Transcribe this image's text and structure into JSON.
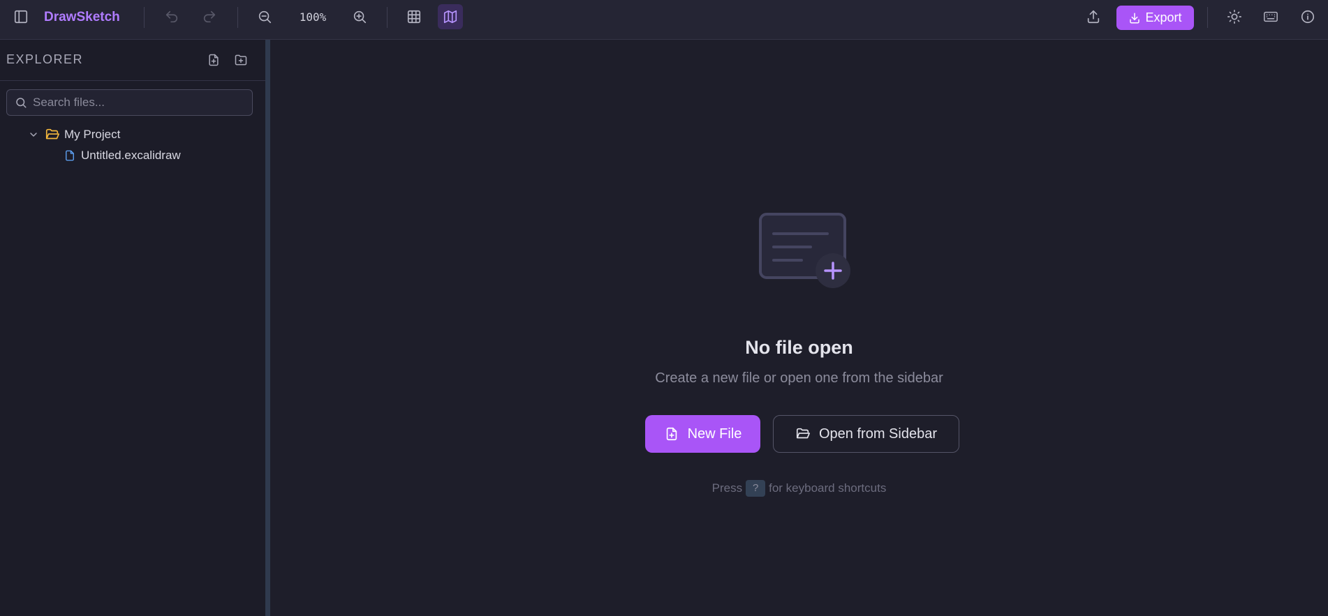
{
  "app": {
    "brand": "DrawSketch"
  },
  "toolbar": {
    "zoom_level": "100%",
    "export_label": "Export",
    "icons": [
      "sidebar-toggle-icon",
      "undo-icon",
      "redo-icon",
      "zoom-out-icon",
      "zoom-in-icon",
      "grid-icon",
      "map-icon",
      "upload-icon",
      "download-icon",
      "sun-icon",
      "keyboard-icon",
      "info-icon"
    ]
  },
  "sidebar": {
    "title": "EXPLORER",
    "search_placeholder": "Search files...",
    "tree": [
      {
        "type": "folder",
        "label": "My Project",
        "expanded": true
      },
      {
        "type": "file",
        "label": "Untitled.excalidraw"
      }
    ]
  },
  "main": {
    "empty_title": "No file open",
    "empty_subtitle": "Create a new file or open one from the sidebar",
    "new_file_label": "New File",
    "open_label": "Open from Sidebar",
    "hint_before": "Press",
    "hint_key": "?",
    "hint_after": "for keyboard shortcuts"
  },
  "colors": {
    "accent": "#a955f7",
    "background": "#1e1e2a",
    "toolbar_bg": "#252534",
    "folder": "#f5b83d",
    "file": "#60a5fa"
  }
}
